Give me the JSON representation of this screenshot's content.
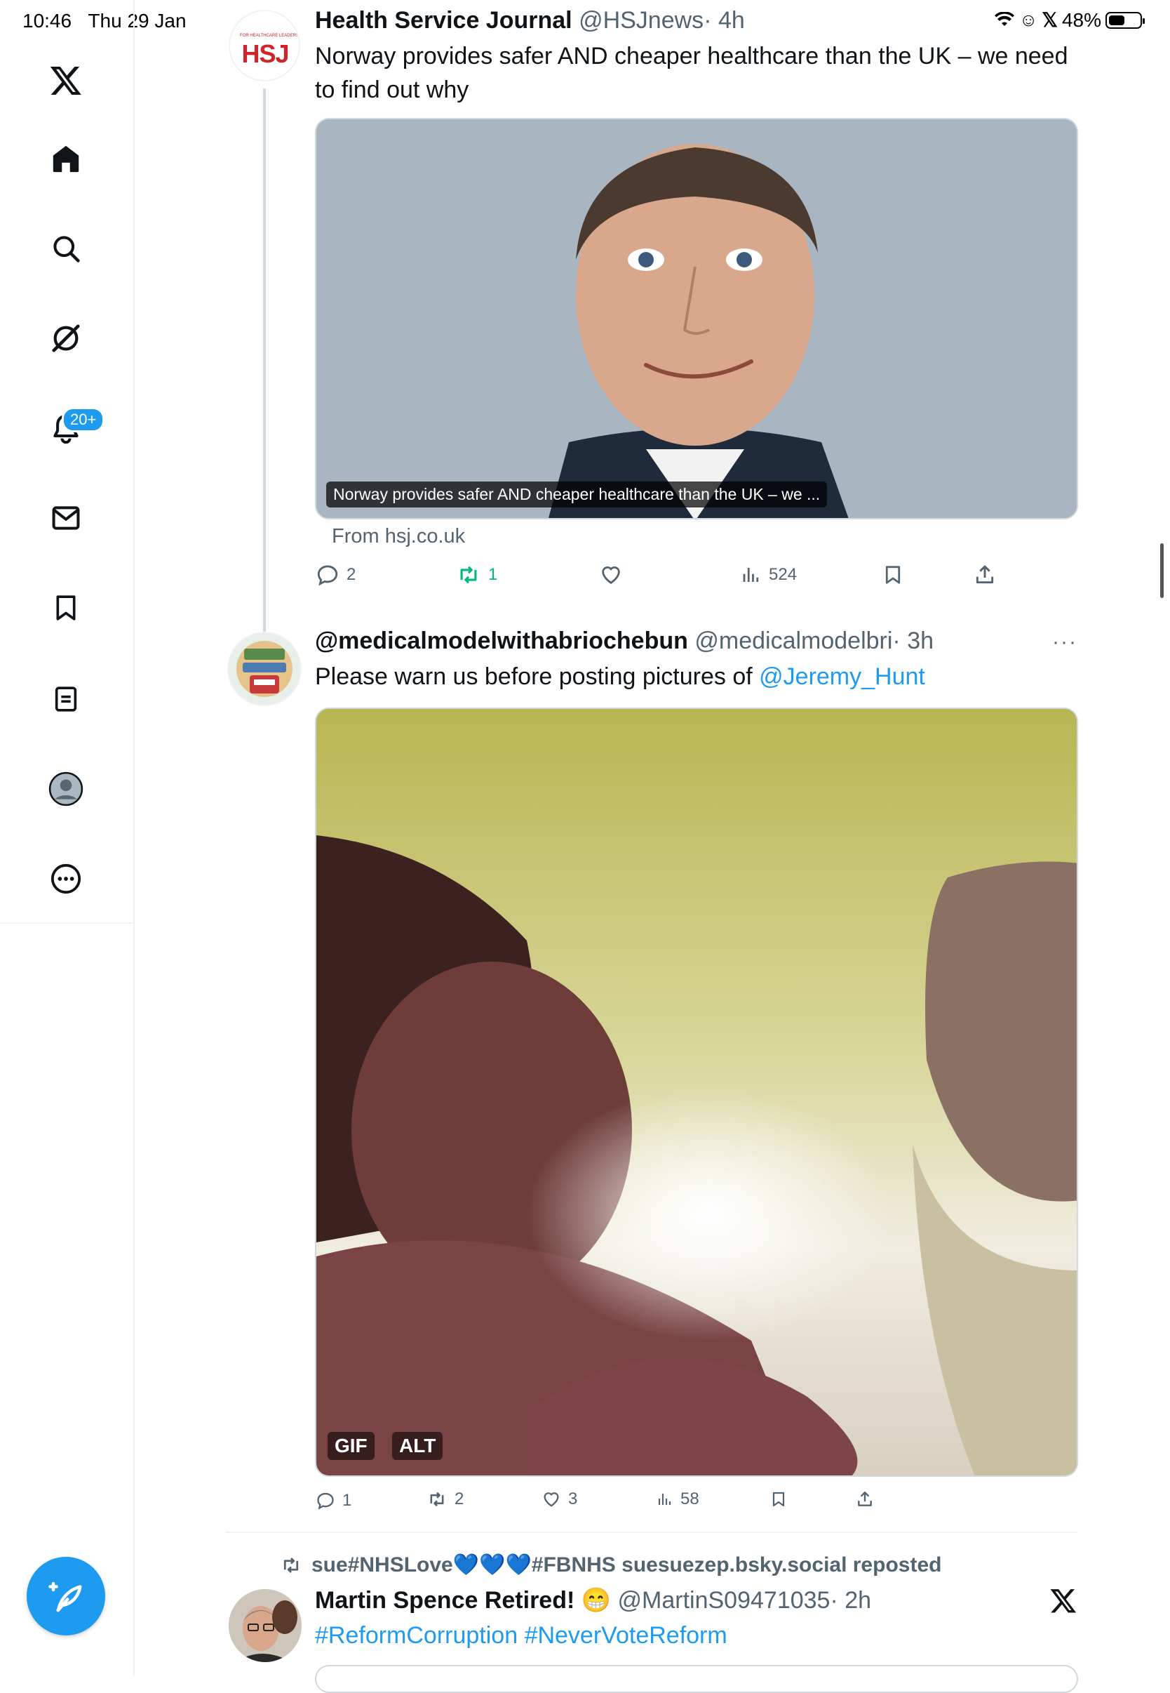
{
  "status_bar": {
    "time": "10:46",
    "date": "Thu 29 Jan",
    "battery": "48%",
    "battery_level": 0.48
  },
  "sidebar": {
    "items": [
      {
        "name": "x-logo-icon"
      },
      {
        "name": "home-icon"
      },
      {
        "name": "search-icon"
      },
      {
        "name": "grok-icon"
      },
      {
        "name": "notifications-icon"
      },
      {
        "name": "messages-icon"
      },
      {
        "name": "bookmarks-icon"
      },
      {
        "name": "lists-icon"
      },
      {
        "name": "profile-icon"
      },
      {
        "name": "more-icon"
      }
    ],
    "notifications_badge": "20+"
  },
  "tweet1": {
    "avatar_text": "HSJ",
    "avatar_small": "FOR HEALTHCARE LEADERS",
    "name": "Health Service Journal",
    "handle": "@HSJnews",
    "time": "· 4h",
    "text": "Norway provides safer AND cheaper healthcare than the UK – we need to find out why",
    "card_caption": "Norway provides safer AND cheaper healthcare than the UK – we ...",
    "card_source": "From hsj.co.uk",
    "replies": "2",
    "reposts": "1",
    "likes": "",
    "views": "524"
  },
  "tweet2": {
    "name": "@medicalmodelwithabriochebun",
    "handle": "@medicalmodelbri",
    "time": "· 3h",
    "text_prefix": "Please warn us before posting pictures of ",
    "mention": "@Jeremy_Hunt",
    "gif_badge": "GIF",
    "alt_badge": "ALT",
    "replies": "1",
    "reposts": "2",
    "likes": "3",
    "views": "58"
  },
  "tweet3": {
    "repost_label": "sue#NHSLove💙💙💙#FBNHS suesuezep.bsky.social reposted",
    "name": "Martin Spence Retired! 😁",
    "handle": "@MartinS09471035",
    "time": "· 2h",
    "hashtags": "#ReformCorruption #NeverVoteReform"
  },
  "colors": {
    "accent": "#1d9bf0",
    "repost_green": "#00ba7c",
    "text": "#0f1419",
    "muted": "#536471"
  }
}
